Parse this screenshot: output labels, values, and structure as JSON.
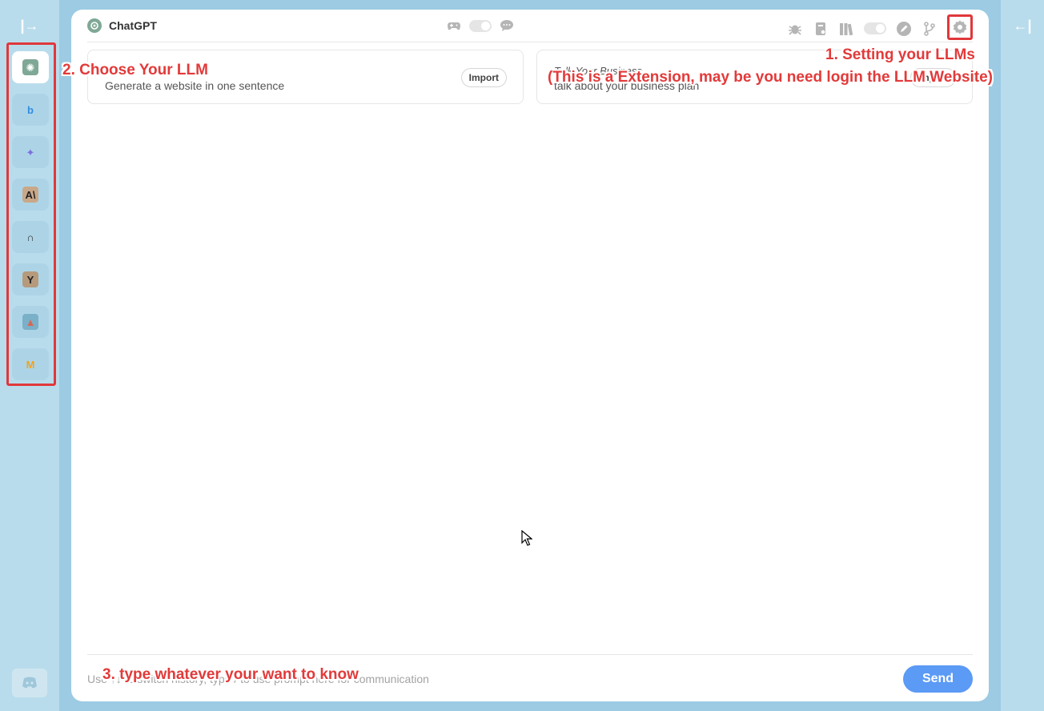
{
  "sidebar": {
    "collapse_glyph": "|→",
    "llms": [
      {
        "name": "chatgpt",
        "glyph": "✺",
        "bg": "#7fa896",
        "fg": "#ffffff"
      },
      {
        "name": "bing",
        "glyph": "b",
        "bg": "transparent",
        "fg": "#2f8de4"
      },
      {
        "name": "gemini",
        "glyph": "✦",
        "bg": "transparent",
        "fg": "#7b6fe0"
      },
      {
        "name": "claude",
        "glyph": "A\\",
        "bg": "#c9a889",
        "fg": "#222222"
      },
      {
        "name": "pi",
        "glyph": "∩",
        "bg": "transparent",
        "fg": "#333333"
      },
      {
        "name": "perplexity",
        "glyph": "Y",
        "bg": "#b69a7c",
        "fg": "#222222"
      },
      {
        "name": "midjourney",
        "glyph": "▲",
        "bg": "#7ab0c8",
        "fg": "#d2695a"
      },
      {
        "name": "mistral",
        "glyph": "M",
        "bg": "transparent",
        "fg": "#f4a11a"
      }
    ],
    "discord_glyph": "◉"
  },
  "right_rail": {
    "expand_glyph": "←|"
  },
  "header": {
    "title": "ChatGPT",
    "logo_glyph": "✺"
  },
  "prompts": [
    {
      "title": "",
      "description": "Generate a website in one sentence",
      "import_label": "Import"
    },
    {
      "title": "Talk Your Business",
      "description": "talk about your business plan",
      "import_label": "Import"
    }
  ],
  "composer": {
    "placeholder": "Use ↑↓ to switch history, type / to use prompt here for communication",
    "send_label": "Send"
  },
  "annotations": {
    "step1": "1. Setting your LLMs",
    "step1_note": "(This is a Extension, may be you need login the LLM Website)",
    "step2": "2. Choose Your LLM",
    "step3": "3. type whatever your want to know"
  },
  "colors": {
    "page_bg": "#9ccbe3",
    "rail_bg": "#b9dcec",
    "highlight": "#e0383b",
    "send_button": "#5b9af5"
  }
}
